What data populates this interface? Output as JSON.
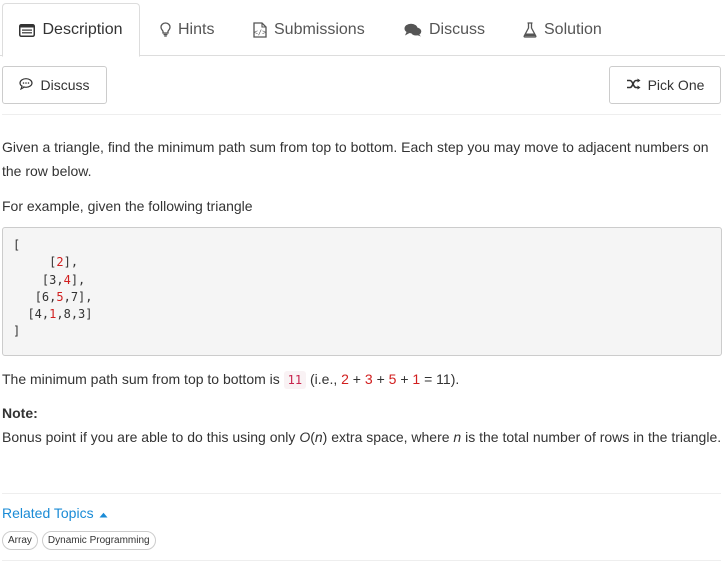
{
  "tabs": [
    {
      "label": "Description",
      "icon": "description-icon",
      "active": true
    },
    {
      "label": "Hints",
      "icon": "lightbulb-icon"
    },
    {
      "label": "Submissions",
      "icon": "submissions-icon"
    },
    {
      "label": "Discuss",
      "icon": "comments-icon"
    },
    {
      "label": "Solution",
      "icon": "flask-icon"
    }
  ],
  "toolbar": {
    "discuss_label": "Discuss",
    "pick_label": "Pick One"
  },
  "problem": {
    "intro": "Given a triangle, find the minimum path sum from top to bottom. Each step you may move to adjacent numbers on the row below.",
    "example_intro": "For example, given the following triangle",
    "triangle_open": "[",
    "triangle_rows": [
      {
        "indent": "     ",
        "before": "[",
        "highlight": "2",
        "after": "],"
      },
      {
        "indent": "    ",
        "before": "[3,",
        "highlight": "4",
        "after": "],"
      },
      {
        "indent": "   ",
        "before": "[6,",
        "highlight": "5",
        "after": ",7],"
      },
      {
        "indent": "  ",
        "before": "[4,",
        "highlight": "1",
        "after": ",8,3]"
      }
    ],
    "triangle_close": "]",
    "result_prefix": "The minimum path sum from top to bottom is",
    "result_value": "11",
    "result_ie": "(i.e.,",
    "sum_terms": [
      "2",
      "3",
      "5",
      "1"
    ],
    "sum_total": "= 11).",
    "note_label": "Note:",
    "note_text_1": "Bonus point if you are able to do this using only",
    "note_o": "O",
    "note_n": "n",
    "note_text_2": "extra space, where",
    "note_text_3": "is the total number of rows in the triangle."
  },
  "related": {
    "label": "Related Topics",
    "tags": [
      "Array",
      "Dynamic Programming"
    ]
  },
  "colors": {
    "link": "#1a8bd6",
    "code_red": "#c7254e",
    "highlight_red": "#d11e1e"
  }
}
